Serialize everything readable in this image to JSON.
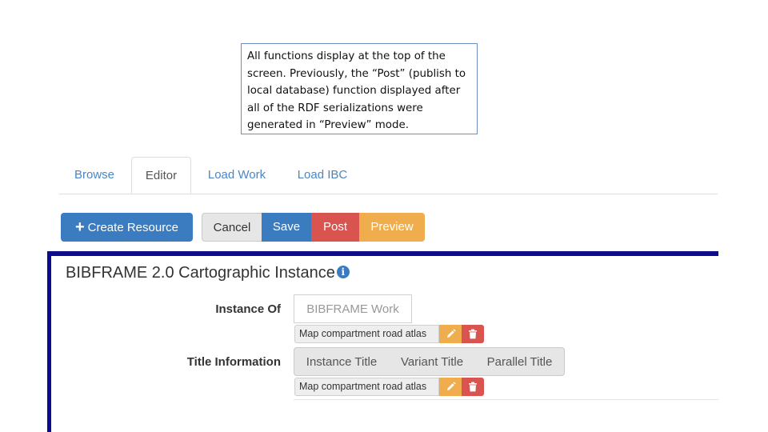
{
  "callout": {
    "text": "All functions display at the top of the screen. Previously, the “Post” (publish to local database) function displayed after all of the RDF serializations were generated in “Preview” mode."
  },
  "tabs": [
    {
      "label": "Browse"
    },
    {
      "label": "Editor",
      "active": true
    },
    {
      "label": "Load Work"
    },
    {
      "label": "Load IBC"
    }
  ],
  "toolbar": {
    "create_label": "Create Resource",
    "cancel_label": "Cancel",
    "save_label": "Save",
    "post_label": "Post",
    "preview_label": "Preview"
  },
  "form": {
    "title": "BIBFRAME 2.0 Cartographic Instance",
    "info_icon": "info-circle-icon",
    "fields": [
      {
        "label": "Instance Of",
        "options": [
          "BIBFRAME Work"
        ],
        "value": "Map compartment road atlas"
      },
      {
        "label": "Title Information",
        "options": [
          "Instance Title",
          "Variant Title",
          "Parallel Title"
        ],
        "value": "Map compartment road atlas"
      }
    ]
  },
  "colors": {
    "primary": "#3b7bbf",
    "danger": "#d9534f",
    "warning": "#f0ad4e",
    "panel_border": "#0c0c8c"
  }
}
